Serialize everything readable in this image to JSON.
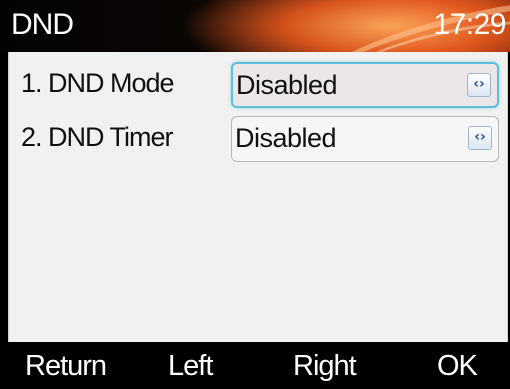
{
  "header": {
    "title": "DND",
    "time": "17:29"
  },
  "settings": [
    {
      "label": "1.  DND Mode",
      "value": "Disabled",
      "focused": true,
      "arrow_glyph": "‹›"
    },
    {
      "label": "2.  DND Timer",
      "value": "Disabled",
      "focused": false,
      "arrow_glyph": "‹›"
    }
  ],
  "softkeys": {
    "return": "Return",
    "left": "Left",
    "right": "Right",
    "ok": "OK"
  },
  "colors": {
    "focus_border": "#5cc0d8",
    "arrow_color": "#1c4f96",
    "content_bg": "#f2f1f1",
    "header_accent": "#c4451a"
  }
}
